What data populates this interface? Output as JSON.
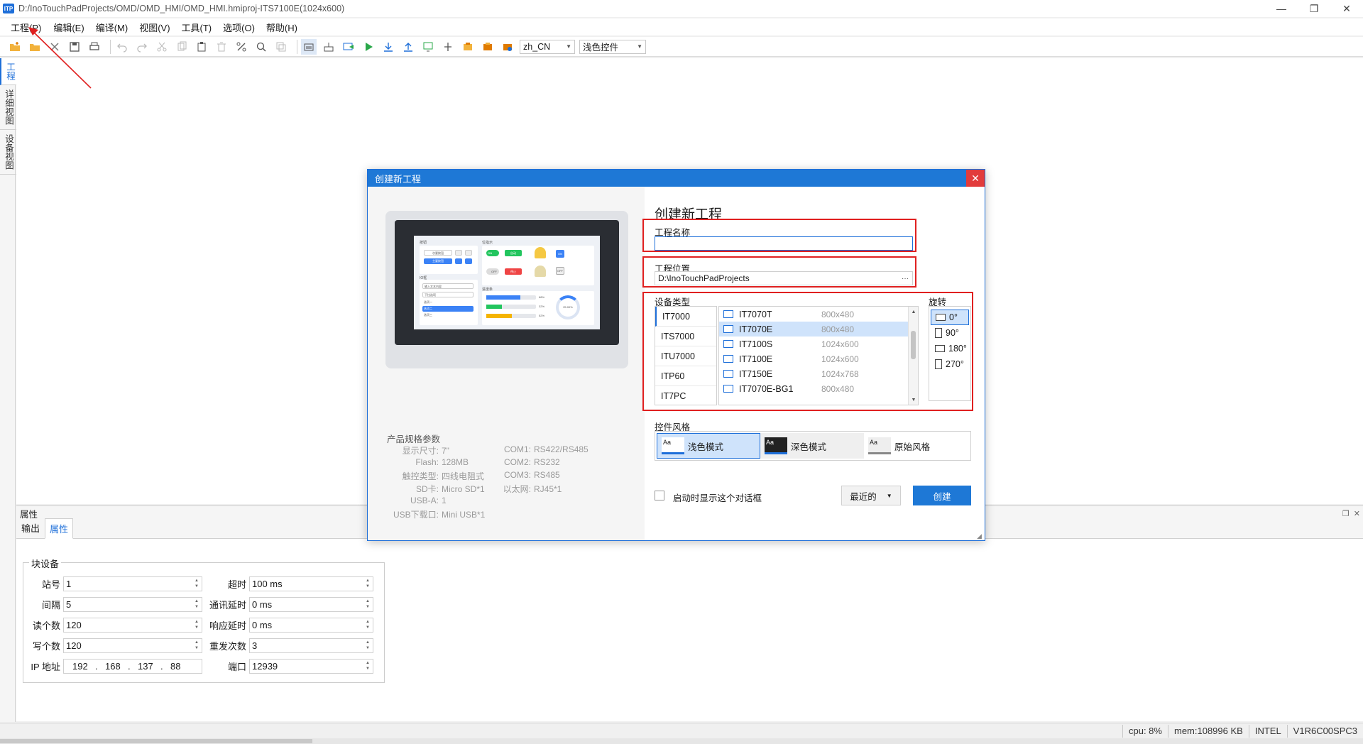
{
  "window": {
    "title": "D:/InoTouchPadProjects/OMD/OMD_HMI/OMD_HMI.hmiproj-ITS7100E(1024x600)",
    "logo_text": "ITP",
    "minimize": "—",
    "restore": "❐",
    "close": "✕"
  },
  "menu": {
    "items": [
      "工程(P)",
      "编辑(E)",
      "编译(M)",
      "视图(V)",
      "工具(T)",
      "选项(O)",
      "帮助(H)"
    ]
  },
  "toolbar": {
    "language": "zh_CN",
    "theme": "浅色控件"
  },
  "left_tabs": [
    "工程",
    "详细视图",
    "设备视图"
  ],
  "property_panel": {
    "header": "属性",
    "tabs": [
      "输出",
      "属性"
    ],
    "active_tab": "属性",
    "group_title": "块设备",
    "fields": {
      "station_label": "站号",
      "station_value": "1",
      "interval_label": "间隔",
      "interval_value": "5",
      "read_label": "读个数",
      "read_value": "120",
      "write_label": "写个数",
      "write_value": "120",
      "ip_label": "IP 地址",
      "ip": [
        "192",
        "168",
        "137",
        "88"
      ],
      "timeout_label": "超时",
      "timeout_value": "100 ms",
      "comm_delay_label": "通讯延时",
      "comm_delay_value": "0 ms",
      "resp_delay_label": "响应延时",
      "resp_delay_value": "0 ms",
      "retry_label": "重发次数",
      "retry_value": "3",
      "port_label": "端口",
      "port_value": "12939"
    }
  },
  "statusbar": {
    "cpu": "cpu:  8%",
    "mem": "mem:108996 KB",
    "arch": "INTEL",
    "version": "V1R6C00SPC3"
  },
  "dialog": {
    "title": "创建新工程",
    "heading": "创建新工程",
    "project_name_label": "工程名称",
    "project_name_value": "",
    "project_location_label": "工程位置",
    "project_location_value": "D:\\InoTouchPadProjects",
    "browse_label": "···",
    "device_type_label": "设备类型",
    "rotation_label": "旋转",
    "series": [
      "IT7000",
      "ITS7000",
      "ITU7000",
      "ITP60",
      "IT7PC"
    ],
    "selected_series": "IT7000",
    "models": [
      {
        "name": "IT7070T",
        "res": "800x480"
      },
      {
        "name": "IT7070E",
        "res": "800x480"
      },
      {
        "name": "IT7100S",
        "res": "1024x600"
      },
      {
        "name": "IT7100E",
        "res": "1024x600"
      },
      {
        "name": "IT7150E",
        "res": "1024x768"
      },
      {
        "name": "IT7070E-BG1",
        "res": "800x480"
      }
    ],
    "selected_model": "IT7070E",
    "rotations": [
      "0°",
      "90°",
      "180°",
      "270°"
    ],
    "selected_rotation": "0°",
    "style_label": "控件风格",
    "styles": [
      "浅色模式",
      "深色模式",
      "原始风格"
    ],
    "selected_style": "浅色模式",
    "style_icon_text": "Aa",
    "show_on_start_label": "启动时显示这个对话框",
    "recent_label": "最近的",
    "create_label": "创建",
    "spec_title": "产品规格参数",
    "specs_left": [
      {
        "k": "显示尺寸:",
        "v": "7\""
      },
      {
        "k": "Flash:",
        "v": "128MB"
      },
      {
        "k": "触控类型:",
        "v": "四线电阻式"
      },
      {
        "k": "SD卡:",
        "v": "Micro SD*1"
      },
      {
        "k": "USB-A:",
        "v": "1"
      },
      {
        "k": "USB下载口:",
        "v": "Mini USB*1"
      }
    ],
    "specs_right": [
      {
        "k": "COM1:",
        "v": "RS422/RS485"
      },
      {
        "k": "COM2:",
        "v": "RS232"
      },
      {
        "k": "COM3:",
        "v": "RS485"
      },
      {
        "k": "以太网:",
        "v": "RJ45*1"
      }
    ],
    "preview": {
      "sec1": "按钮",
      "sec2": "位指示",
      "sec3": "IO框",
      "sec4": "进度条",
      "btn1": "次要按钮",
      "btn2": "主要按钮",
      "on": "ON",
      "off": "OFF",
      "auto": "自动",
      "stop": "停止",
      "input_placeholder": "输入文本内容",
      "dropdown": "下拉选项",
      "opt1": "选项一",
      "opt2": "选项二",
      "opt3": "选项三",
      "p1": "68%",
      "p2": "32%",
      "p3": "52%",
      "ring": "25.00%"
    }
  }
}
